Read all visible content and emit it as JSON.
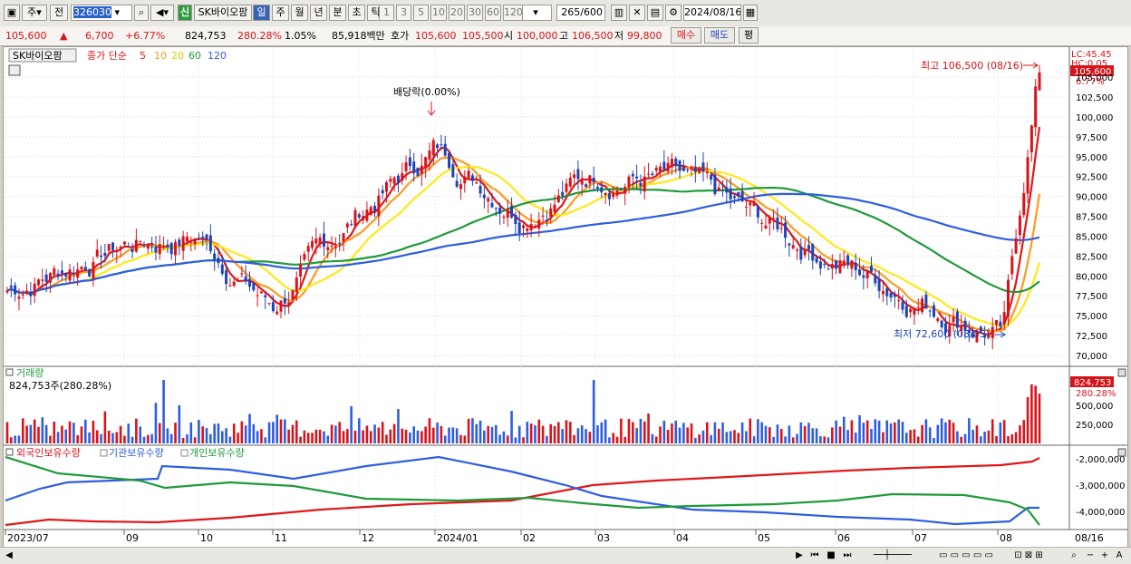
{
  "toolbar": {
    "period_label": "주",
    "prev_label": "전",
    "stock_code": "326030",
    "sin_label": "신",
    "stock_name": "SK바이오팜",
    "period_tabs": [
      "일",
      "주",
      "월",
      "년",
      "분",
      "초",
      "틱"
    ],
    "period_selected": "일",
    "minute_options": [
      "1",
      "3",
      "5",
      "10",
      "20",
      "30",
      "60",
      "120"
    ],
    "count_value": "265",
    "count_total": "/600",
    "date_value": "2024/08/16"
  },
  "info": {
    "price": "105,600",
    "change_arrow": "▲",
    "change": "6,700",
    "change_pct": "+6.77%",
    "volume": "824,753",
    "volume_ratio": "280.28%",
    "turnover": "1.05%",
    "amount": "85,918백만",
    "ask_label": "호가",
    "ask1": "105,600",
    "ask2": "105,500",
    "open_label": "시",
    "open": "100,000",
    "high_label": "고",
    "high": "106,500",
    "low_label": "저",
    "low": "99,800",
    "buy_label": "매수",
    "sell_label": "매도",
    "eval_label": "평"
  },
  "price_panel": {
    "name_tag": "SK바이오팜",
    "legend_prefix": "종가 단순",
    "ma_periods": [
      "5",
      "10",
      "20",
      "60",
      "120"
    ],
    "ma_colors": [
      "#e01818",
      "#ff9a1e",
      "#ffe81a",
      "#1f9a3a",
      "#2e5ee0"
    ],
    "lc_label": "LC:45.45",
    "hc_label": "HC:0.05",
    "current_price_tag": "105,600",
    "current_pct_tag": "6.77%",
    "high_annotation": "최고 106,500 (08/16)",
    "low_annotation": "최저 72,600 (08/05)",
    "dividend_annotation": "배당락(0.00%)",
    "y_ticks": [
      "105,000",
      "102,500",
      "100,000",
      "97,500",
      "95,000",
      "92,500",
      "90,000",
      "87,500",
      "85,000",
      "82,500",
      "80,000",
      "77,500",
      "75,000",
      "72,500",
      "70,000"
    ]
  },
  "volume_panel": {
    "title": "거래량",
    "value_label": "824,753주(280.28%)",
    "tag_value": "824,753",
    "tag_pct": "280.28%",
    "y_ticks": [
      "500,000",
      "250,000"
    ]
  },
  "holding_panel": {
    "legend": [
      "외국인보유수량",
      "기관보유수량",
      "개인보유수량"
    ],
    "colors": [
      "#e01818",
      "#2e5ee0",
      "#1f9a3a"
    ],
    "y_ticks": [
      "-2,000,000",
      "-3,000,000",
      "-4,000,000"
    ]
  },
  "x_axis": {
    "labels": [
      "2023/07",
      "09",
      "10",
      "11",
      "12",
      "2024/01",
      "02",
      "03",
      "04",
      "05",
      "06",
      "07",
      "08"
    ],
    "end_label": "08/16"
  },
  "chart_data": [
    {
      "type": "line",
      "title": "SK바이오팜",
      "series": [
        {
          "name": "종가",
          "x": [
            "2023/07",
            "2023/09",
            "2023/10",
            "2023/11",
            "2023/12",
            "2024/01",
            "2024/02",
            "2024/03",
            "2024/04",
            "2024/05",
            "2024/06",
            "2024/07",
            "2024/08/05",
            "2024/08/16"
          ],
          "values": [
            78000,
            84000,
            85000,
            76000,
            88000,
            96000,
            88500,
            93000,
            92000,
            87000,
            82000,
            77500,
            72600,
            105600
          ]
        }
      ],
      "ylim": [
        70000,
        106500
      ]
    },
    {
      "type": "bar",
      "title": "거래량",
      "series": [
        {
          "name": "거래량",
          "last_value": 824753
        }
      ]
    }
  ]
}
